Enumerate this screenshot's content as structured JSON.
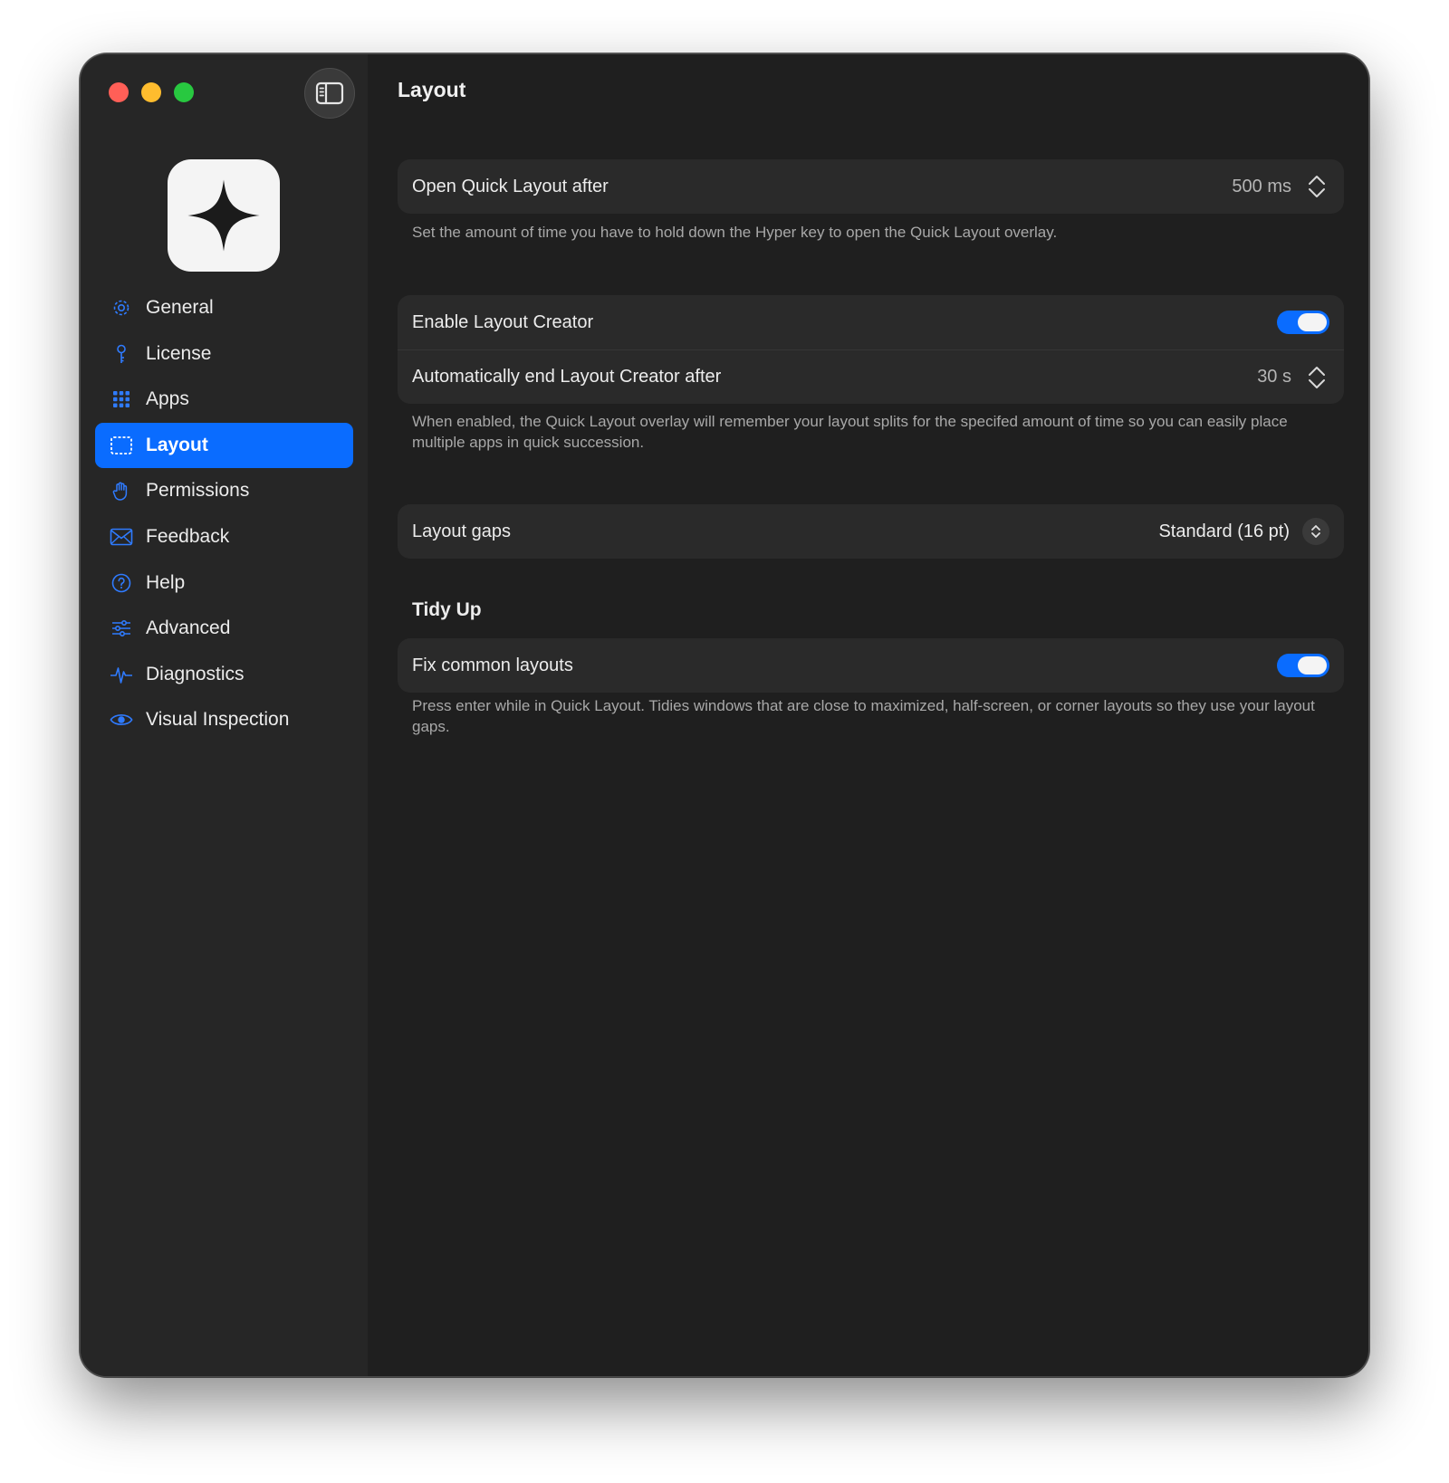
{
  "window": {
    "accent_color": "#0a6cff"
  },
  "sidebar": {
    "items": [
      {
        "label": "General",
        "icon": "gear-icon"
      },
      {
        "label": "License",
        "icon": "key-icon"
      },
      {
        "label": "Apps",
        "icon": "grid-icon"
      },
      {
        "label": "Layout",
        "icon": "layout-frame-icon",
        "active": true
      },
      {
        "label": "Permissions",
        "icon": "hand-icon"
      },
      {
        "label": "Feedback",
        "icon": "envelope-icon"
      },
      {
        "label": "Help",
        "icon": "question-circle-icon"
      },
      {
        "label": "Advanced",
        "icon": "sliders-icon"
      },
      {
        "label": "Diagnostics",
        "icon": "waveform-icon"
      },
      {
        "label": "Visual Inspection",
        "icon": "eye-icon"
      }
    ]
  },
  "main": {
    "title": "Layout",
    "quick_layout": {
      "label": "Open Quick Layout after",
      "value": "500 ms",
      "description": "Set the amount of time you have to hold down the Hyper key to open the Quick Layout overlay."
    },
    "layout_creator": {
      "enable_label": "Enable Layout Creator",
      "enabled": true,
      "auto_end_label": "Automatically end Layout Creator after",
      "auto_end_value": "30 s",
      "description": "When enabled, the Quick Layout overlay will remember your layout splits for the specifed amount of time so you can easily place multiple apps in quick succession."
    },
    "layout_gaps": {
      "label": "Layout gaps",
      "value": "Standard (16 pt)"
    },
    "tidy_up": {
      "section_title": "Tidy Up",
      "fix_label": "Fix common layouts",
      "enabled": true,
      "description": "Press enter while in Quick Layout. Tidies windows that are close to maximized, half-screen, or corner layouts so they use your layout gaps."
    }
  }
}
